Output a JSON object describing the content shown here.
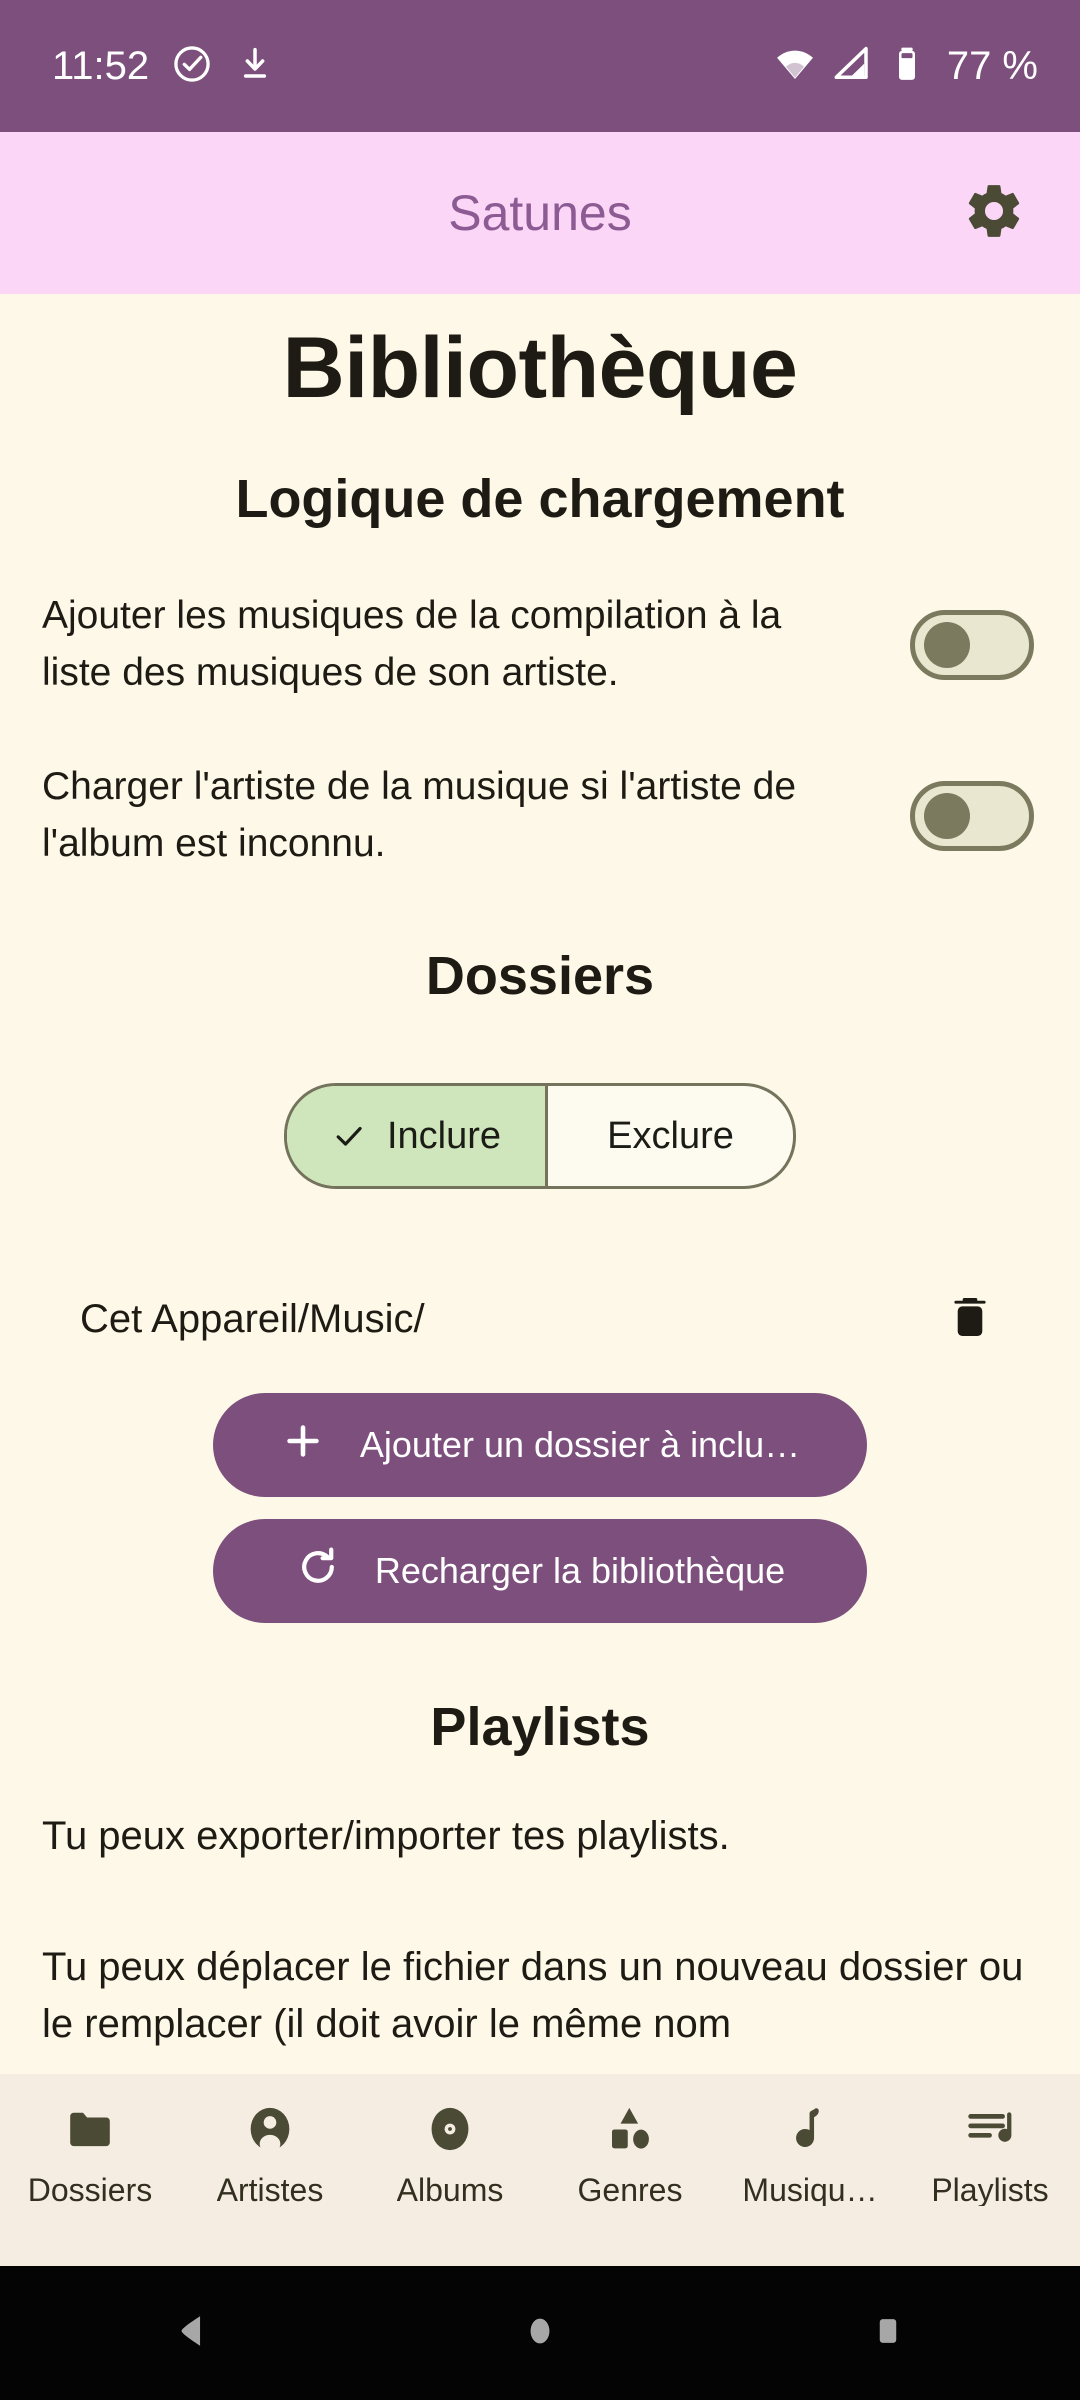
{
  "status_bar": {
    "time": "11:52",
    "battery_percent": "77 %",
    "icons": [
      "check-circle-icon",
      "download-icon",
      "wifi-icon",
      "cellular-signal-icon",
      "battery-icon"
    ],
    "background_color": "#7C4F7C"
  },
  "app_bar": {
    "title": "Satunes",
    "settings_icon": "gear-icon",
    "background_color": "#FBD6F7",
    "title_color": "#8C5B93"
  },
  "page": {
    "title": "Bibliothèque"
  },
  "loading_logic": {
    "section_title": "Logique de chargement",
    "settings": [
      {
        "label": "Ajouter les musiques de la compilation à la liste des musiques de son artiste.",
        "enabled": false
      },
      {
        "label": "Charger l'artiste de la musique si l'artiste de l'album est inconnu.",
        "enabled": false
      }
    ]
  },
  "folders": {
    "section_title": "Dossiers",
    "segmented": {
      "options": [
        {
          "label": "Inclure",
          "selected": true,
          "icon": "check-icon"
        },
        {
          "label": "Exclure",
          "selected": false
        }
      ],
      "selected_bg": "#CFE6BD"
    },
    "folder_list": [
      {
        "path": "Cet Appareil/Music/",
        "delete_icon": "trash-icon"
      }
    ],
    "buttons": [
      {
        "label": "Ajouter un dossier à inclu…",
        "icon": "plus-icon"
      },
      {
        "label": "Recharger la bibliothèque",
        "icon": "refresh-icon"
      }
    ],
    "button_color": "#7C4F7C"
  },
  "playlists": {
    "section_title": "Playlists",
    "paragraph_1": "Tu peux exporter/importer tes playlists.",
    "paragraph_2": "Tu peux déplacer le fichier dans un nouveau dossier ou le remplacer (il doit avoir le même nom"
  },
  "bottom_nav": {
    "background_color": "#F5EDE2",
    "items": [
      {
        "label": "Dossiers",
        "icon": "folder-icon"
      },
      {
        "label": "Artistes",
        "icon": "account-circle-icon"
      },
      {
        "label": "Albums",
        "icon": "album-disc-icon"
      },
      {
        "label": "Genres",
        "icon": "genres-shapes-icon"
      },
      {
        "label": "Musiqu…",
        "icon": "music-note-icon"
      },
      {
        "label": "Playlists",
        "icon": "playlist-icon"
      }
    ]
  },
  "system_nav": {
    "buttons": [
      {
        "name": "back",
        "icon": "triangle-back-icon"
      },
      {
        "name": "home",
        "icon": "circle-home-icon"
      },
      {
        "name": "recents",
        "icon": "square-recents-icon"
      }
    ]
  }
}
